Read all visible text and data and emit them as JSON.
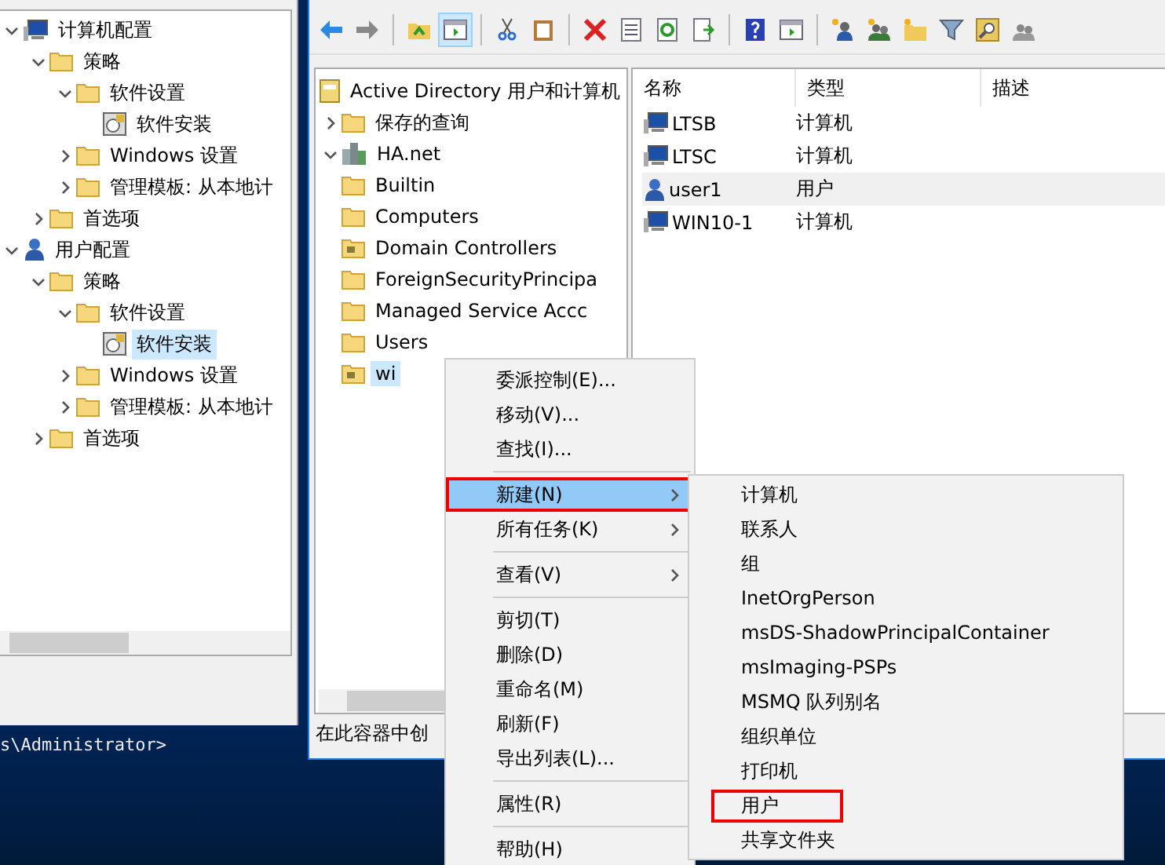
{
  "gpo_tree": [
    {
      "label": "计算机配置",
      "kind": "computer-config",
      "expanded": true,
      "selected": false,
      "children": [
        {
          "label": "策略",
          "kind": "folder",
          "expanded": true,
          "selected": false,
          "children": [
            {
              "label": "软件设置",
              "kind": "folder",
              "expanded": true,
              "selected": false,
              "children": [
                {
                  "label": "软件安装",
                  "kind": "install",
                  "selected": false
                }
              ]
            },
            {
              "label": "Windows 设置",
              "kind": "folder",
              "expanded": false,
              "selected": false
            },
            {
              "label": "管理模板: 从本地计",
              "kind": "folder",
              "expanded": false,
              "selected": false
            }
          ]
        },
        {
          "label": "首选项",
          "kind": "folder",
          "expanded": false,
          "selected": false
        }
      ]
    },
    {
      "label": "用户配置",
      "kind": "user-config",
      "expanded": true,
      "selected": false,
      "children": [
        {
          "label": "策略",
          "kind": "folder",
          "expanded": true,
          "selected": false,
          "children": [
            {
              "label": "软件设置",
              "kind": "folder",
              "expanded": true,
              "selected": false,
              "children": [
                {
                  "label": "软件安装",
                  "kind": "install",
                  "selected": true
                }
              ]
            },
            {
              "label": "Windows 设置",
              "kind": "folder",
              "expanded": false,
              "selected": false
            },
            {
              "label": "管理模板: 从本地计",
              "kind": "folder",
              "expanded": false,
              "selected": false
            }
          ]
        },
        {
          "label": "首选项",
          "kind": "folder",
          "expanded": false,
          "selected": false
        }
      ]
    }
  ],
  "toolbar": [
    {
      "kind": "back",
      "pressed": false
    },
    {
      "kind": "forward",
      "pressed": false
    },
    {
      "kind": "sep"
    },
    {
      "kind": "up",
      "pressed": false
    },
    {
      "kind": "pane",
      "pressed": true
    },
    {
      "kind": "sep"
    },
    {
      "kind": "cut",
      "pressed": false
    },
    {
      "kind": "paste",
      "pressed": false
    },
    {
      "kind": "sep"
    },
    {
      "kind": "delete",
      "pressed": false
    },
    {
      "kind": "properties",
      "pressed": false
    },
    {
      "kind": "refresh",
      "pressed": false
    },
    {
      "kind": "export",
      "pressed": false
    },
    {
      "kind": "sep"
    },
    {
      "kind": "help",
      "pressed": false
    },
    {
      "kind": "action-pane",
      "pressed": false
    },
    {
      "kind": "sep"
    },
    {
      "kind": "new-user",
      "pressed": false
    },
    {
      "kind": "new-group",
      "pressed": false
    },
    {
      "kind": "new-ou",
      "pressed": false
    },
    {
      "kind": "filter",
      "pressed": false
    },
    {
      "kind": "find",
      "pressed": false
    },
    {
      "kind": "add-group",
      "pressed": false
    }
  ],
  "ad_tree": [
    {
      "label": "Active Directory 用户和计算机",
      "kind": "root",
      "selected": false,
      "children": [
        {
          "label": "保存的查询",
          "kind": "folder",
          "expanded": false,
          "selected": false
        },
        {
          "label": "HA.net",
          "kind": "domain",
          "expanded": true,
          "selected": false,
          "children": [
            {
              "label": "Builtin",
              "kind": "folder",
              "selected": false
            },
            {
              "label": "Computers",
              "kind": "folder",
              "selected": false
            },
            {
              "label": "Domain Controllers",
              "kind": "ou",
              "selected": false
            },
            {
              "label": "ForeignSecurityPrincipa",
              "kind": "folder",
              "selected": false
            },
            {
              "label": "Managed Service Accc",
              "kind": "folder",
              "selected": false
            },
            {
              "label": "Users",
              "kind": "folder",
              "selected": false
            },
            {
              "label": "wi",
              "kind": "ou",
              "selected": true
            }
          ]
        }
      ]
    }
  ],
  "list": {
    "columns": [
      "名称",
      "类型",
      "描述"
    ],
    "rows": [
      {
        "kind": "computer",
        "name": "LTSB",
        "type": "计算机",
        "selected": false
      },
      {
        "kind": "computer",
        "name": "LTSC",
        "type": "计算机",
        "selected": false
      },
      {
        "kind": "user",
        "name": "user1",
        "type": "用户",
        "selected": true
      },
      {
        "kind": "computer",
        "name": "WIN10-1",
        "type": "计算机",
        "selected": false
      }
    ]
  },
  "status_bar": "在此容器中创",
  "console": "s\\Administrator>",
  "context_menu": [
    {
      "kind": "item",
      "label": "委派控制(E)...",
      "submenu": false,
      "selected": false,
      "highlighted": false
    },
    {
      "kind": "item",
      "label": "移动(V)...",
      "submenu": false,
      "selected": false,
      "highlighted": false
    },
    {
      "kind": "item",
      "label": "查找(I)...",
      "submenu": false,
      "selected": false,
      "highlighted": false
    },
    {
      "kind": "separator"
    },
    {
      "kind": "item",
      "label": "新建(N)",
      "submenu": true,
      "selected": true,
      "highlighted": true
    },
    {
      "kind": "item",
      "label": "所有任务(K)",
      "submenu": true,
      "selected": false,
      "highlighted": false
    },
    {
      "kind": "separator"
    },
    {
      "kind": "item",
      "label": "查看(V)",
      "submenu": true,
      "selected": false,
      "highlighted": false
    },
    {
      "kind": "separator"
    },
    {
      "kind": "item",
      "label": "剪切(T)",
      "submenu": false,
      "selected": false,
      "highlighted": false
    },
    {
      "kind": "item",
      "label": "删除(D)",
      "submenu": false,
      "selected": false,
      "highlighted": false
    },
    {
      "kind": "item",
      "label": "重命名(M)",
      "submenu": false,
      "selected": false,
      "highlighted": false
    },
    {
      "kind": "item",
      "label": "刷新(F)",
      "submenu": false,
      "selected": false,
      "highlighted": false
    },
    {
      "kind": "item",
      "label": "导出列表(L)...",
      "submenu": false,
      "selected": false,
      "highlighted": false
    },
    {
      "kind": "separator"
    },
    {
      "kind": "item",
      "label": "属性(R)",
      "submenu": false,
      "selected": false,
      "highlighted": false
    },
    {
      "kind": "separator"
    },
    {
      "kind": "item",
      "label": "帮助(H)",
      "submenu": false,
      "selected": false,
      "highlighted": false
    }
  ],
  "submenu": [
    {
      "label": "计算机",
      "highlighted": false
    },
    {
      "label": "联系人",
      "highlighted": false
    },
    {
      "label": "组",
      "highlighted": false
    },
    {
      "label": "InetOrgPerson",
      "highlighted": false
    },
    {
      "label": "msDS-ShadowPrincipalContainer",
      "highlighted": false
    },
    {
      "label": "msImaging-PSPs",
      "highlighted": false
    },
    {
      "label": "MSMQ 队列别名",
      "highlighted": false
    },
    {
      "label": "组织单位",
      "highlighted": false
    },
    {
      "label": "打印机",
      "highlighted": false
    },
    {
      "label": "用户",
      "highlighted": true
    },
    {
      "label": "共享文件夹",
      "highlighted": false
    }
  ]
}
